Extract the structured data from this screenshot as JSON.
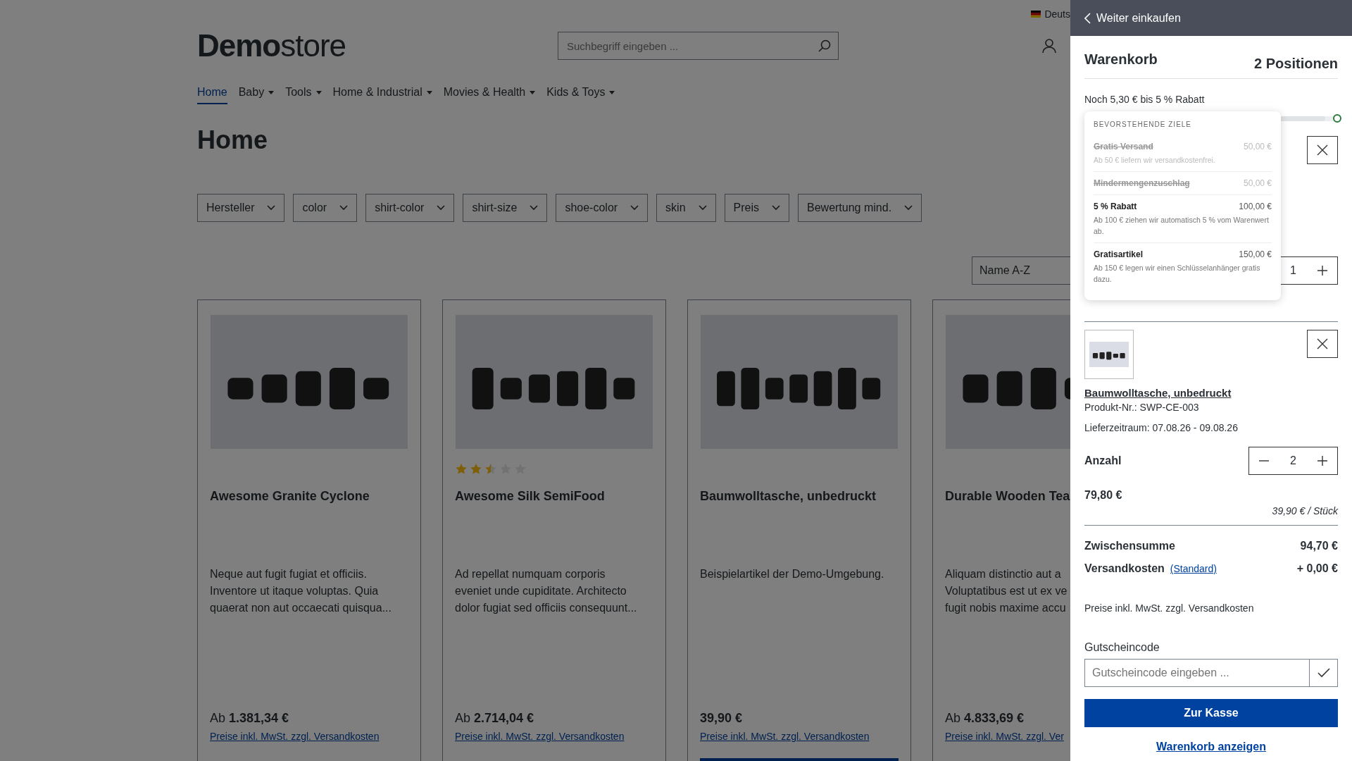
{
  "language": {
    "label": "Deuts"
  },
  "logo": {
    "bold": "Demo",
    "light": "store"
  },
  "search": {
    "placeholder": "Suchbegriff eingeben ..."
  },
  "nav": [
    {
      "label": "Home",
      "selected": true,
      "dropdown": false
    },
    {
      "label": "Baby",
      "selected": false,
      "dropdown": true
    },
    {
      "label": "Tools",
      "selected": false,
      "dropdown": true
    },
    {
      "label": "Home & Industrial",
      "selected": false,
      "dropdown": true
    },
    {
      "label": "Movies & Health",
      "selected": false,
      "dropdown": true
    },
    {
      "label": "Kids & Toys",
      "selected": false,
      "dropdown": true
    }
  ],
  "page_title": "Home",
  "filters": [
    "Hersteller",
    "color",
    "shirt-color",
    "shirt-size",
    "shoe-color",
    "skin",
    "Preis",
    "Bewertung mind."
  ],
  "sort": {
    "value": "Name A-Z"
  },
  "products": [
    {
      "name": "Awesome Granite Cyclone",
      "description": "Neque aut fugit fugiat et officiis.\nInventore ut itaque voluptas. Quia\nquaerat non aut occaecati quisqua...",
      "price_prefix": "Ab",
      "price": "1.381,34 €",
      "tax_link": "Preise inkl. MwSt. zzgl. Versandkosten",
      "button": false
    },
    {
      "name": "Awesome Silk SemiFood",
      "stars": 2.5,
      "description": "Ad repellat numquam corporis\neveniet unde cupiditate. Architecto\ndolor fugiat sed officiis consequunt...",
      "price_prefix": "Ab",
      "price": "2.714,04 €",
      "tax_link": "Preise inkl. MwSt. zzgl. Versandkosten",
      "button": false
    },
    {
      "name": "Baumwolltasche, unbedruckt",
      "description": "Beispielartikel der Demo-Umgebung.",
      "price": "39,90 €",
      "tax_link": "Preise inkl. MwSt. zzgl. Versandkosten",
      "button": true
    },
    {
      "name": "Durable Wooden Tea",
      "description": "Aliquam distinctio aut a\nVoluptatibus est ut ex ve\nfugit nobis maxime accu",
      "price_prefix": "Ab",
      "price": "4.833,69 €",
      "tax_link": "Preise inkl. MwSt. zzgl. Ver",
      "button": false
    }
  ],
  "offcanvas": {
    "back": "Weiter einkaufen",
    "title": "Warenkorb",
    "count": "2 Positionen",
    "goal_hint": "Noch 5,30 € bis 5 % Rabatt",
    "goal_progress": {
      "level": 0.95
    },
    "goals": {
      "title": "BEVORSTEHENDE ZIELE",
      "items": [
        {
          "name": "Gratis Versand",
          "amount": "50,00 €",
          "description": "Ab 50 € liefern wir versandkostenfrei.",
          "reached": true
        },
        {
          "name": "Mindermengenzuschlag",
          "amount": "50,00 €",
          "reached": true
        },
        {
          "name": "5 % Rabatt",
          "amount": "100,00 €",
          "description": "Ab 100 € ziehen wir automatisch 5 % vom Warenwert ab.",
          "reached": false
        },
        {
          "name": "Gratisartikel",
          "amount": "150,00 €",
          "description": "Ab 150 € legen wir einen Schlüsselanhänger gratis dazu.",
          "reached": false
        }
      ]
    },
    "items": [
      {
        "covered": true,
        "quantity": "1"
      },
      {
        "covered": false,
        "name": "Baumwolltasche, unbedruckt",
        "number": "Produkt-Nr.: SWP-CE-003",
        "delivery": "Lieferzeitraum: 07.08.26 - 09.08.26",
        "quantity_label": "Anzahl",
        "quantity": "2",
        "total": "79,80 €",
        "unit_price": "39,90 € / Stück"
      }
    ],
    "subtotal": {
      "label": "Zwischensumme",
      "value": "94,70 €"
    },
    "shipping": {
      "label": "Versandkosten",
      "link": "(Standard)",
      "value": "+ 0,00 €"
    },
    "tax_note": "Preise inkl. MwSt. zzgl. Versandkosten",
    "voucher": {
      "label": "Gutscheincode",
      "placeholder": "Gutscheincode eingeben ..."
    },
    "checkout": "Zur Kasse",
    "view_cart": "Warenkorb anzeigen"
  }
}
